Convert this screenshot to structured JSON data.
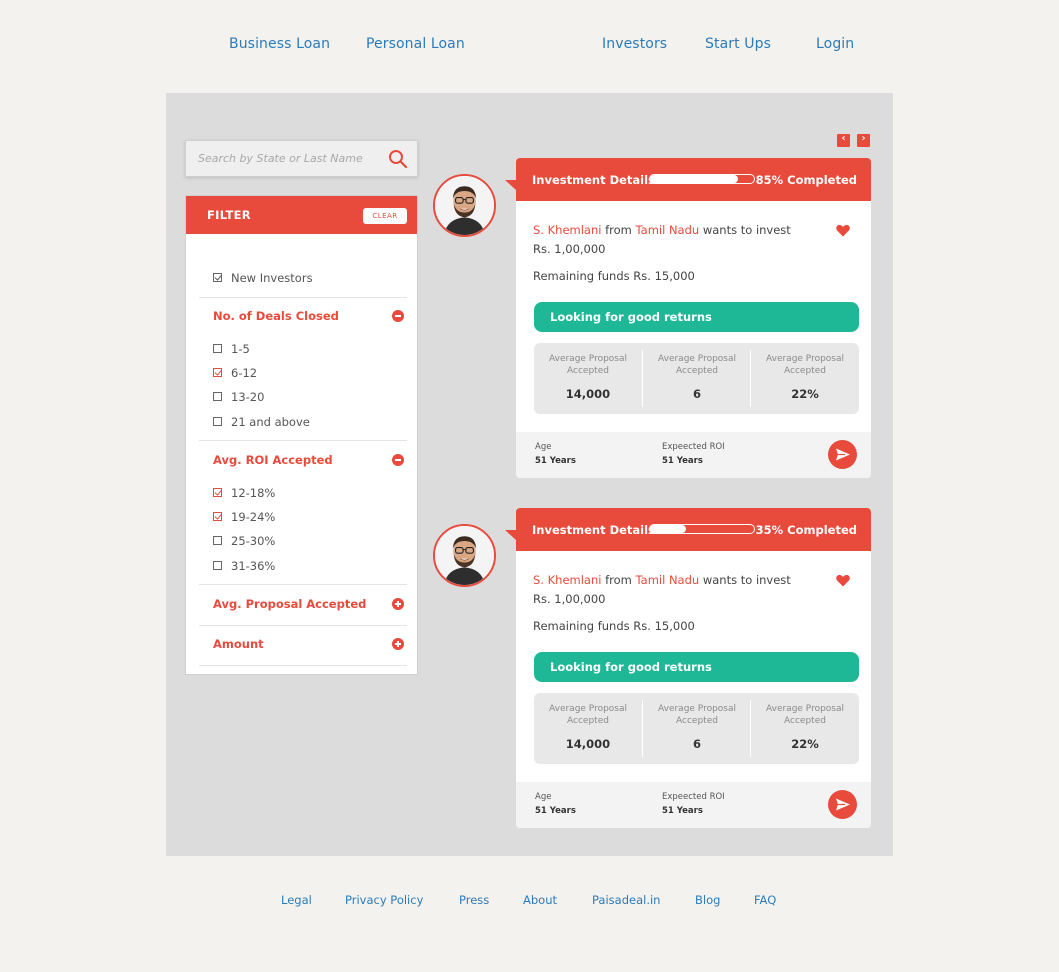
{
  "nav": {
    "business_loan": "Business Loan",
    "personal_loan": "Personal Loan",
    "investors": "Investors",
    "start_ups": "Start Ups",
    "login": "Login"
  },
  "search": {
    "placeholder": "Search by State or Last Name",
    "icon": "search-icon"
  },
  "filter": {
    "title": "FILTER",
    "clear_label": "CLEAR",
    "new_investors": {
      "label": "New Investors",
      "checked": true
    },
    "sections": [
      {
        "title": "No. of Deals Closed",
        "expanded": true,
        "options": [
          {
            "label": "1-5",
            "checked": false
          },
          {
            "label": "6-12",
            "checked": true
          },
          {
            "label": "13-20",
            "checked": false
          },
          {
            "label": "21 and above",
            "checked": false
          }
        ]
      },
      {
        "title": "Avg. ROI Accepted",
        "expanded": true,
        "options": [
          {
            "label": "12-18%",
            "checked": true
          },
          {
            "label": "19-24%",
            "checked": true
          },
          {
            "label": "25-30%",
            "checked": false
          },
          {
            "label": "31-36%",
            "checked": false
          }
        ]
      },
      {
        "title": "Avg. Proposal Accepted",
        "expanded": false,
        "options": []
      },
      {
        "title": "Amount",
        "expanded": false,
        "options": []
      }
    ]
  },
  "pager": {
    "prev": "‹",
    "next": "›"
  },
  "cards": [
    {
      "header_label": "Investment Details",
      "progress": 0.85,
      "progress_label": "85% Completed",
      "investor_name": "S. Khemlani",
      "from_word": "from",
      "state": "Tamil Nadu",
      "action_text": "wants to invest",
      "amount": "Rs. 1,00,000",
      "remaining": "Remaining funds Rs. 15,000",
      "tagline": "Looking for good returns",
      "stats": [
        {
          "label": "Average Proposal Accepted",
          "value": "14,000"
        },
        {
          "label": "Average Proposal Accepted",
          "value": "6"
        },
        {
          "label": "Average Proposal Accepted",
          "value": "22%"
        }
      ],
      "age_label": "Age",
      "age_value": "51 Years",
      "roi_label": "Expeected ROI",
      "roi_value": "51 Years"
    },
    {
      "header_label": "Investment Details",
      "progress": 0.35,
      "progress_label": "35% Completed",
      "investor_name": "S. Khemlani",
      "from_word": "from",
      "state": "Tamil Nadu",
      "action_text": "wants to invest",
      "amount": "Rs. 1,00,000",
      "remaining": "Remaining funds Rs. 15,000",
      "tagline": "Looking for good returns",
      "stats": [
        {
          "label": "Average Proposal Accepted",
          "value": "14,000"
        },
        {
          "label": "Average Proposal Accepted",
          "value": "6"
        },
        {
          "label": "Average Proposal Accepted",
          "value": "22%"
        }
      ],
      "age_label": "Age",
      "age_value": "51 Years",
      "roi_label": "Expeected ROI",
      "roi_value": "51 Years"
    }
  ],
  "footer": {
    "legal": "Legal",
    "privacy": "Privacy Policy",
    "press": "Press",
    "about": "About",
    "paisadeal": "Paisadeal.in",
    "blog": "Blog",
    "faq": "FAQ"
  },
  "colors": {
    "accent": "#e84a3c",
    "teal": "#1fb896",
    "link": "#2b7bb9",
    "panel": "#dcdcdc"
  }
}
